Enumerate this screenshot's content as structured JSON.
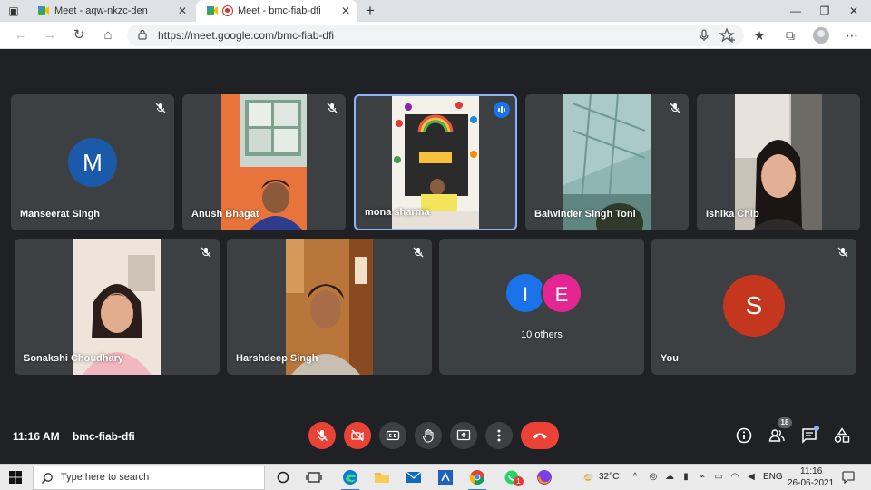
{
  "browser": {
    "tabs": [
      {
        "title": "Meet - aqw-nkzc-den"
      },
      {
        "title": "Meet - bmc-fiab-dfi"
      }
    ],
    "close_glyph": "✕",
    "new_tab_glyph": "+",
    "window_controls": {
      "minimize": "—",
      "restore": "❐",
      "close": "✕"
    },
    "url": "https://meet.google.com/bmc-fiab-dfi",
    "nav": {
      "back": "←",
      "forward": "→",
      "reload": "↻",
      "home": "⌂"
    },
    "toolbar": {
      "favorites": "☆",
      "favorites_bar": "★",
      "collections": "⧉",
      "more": "⋯"
    }
  },
  "meet": {
    "participants_row1": [
      {
        "name": "Manseerat Singh",
        "avatar_letter": "M",
        "avatar_color": "#1a5aa8"
      },
      {
        "name": "Anush Bhagat"
      },
      {
        "name": "mona sharma"
      },
      {
        "name": "Balwinder Singh Toni"
      },
      {
        "name": "Ishika Chib"
      }
    ],
    "participants_row2": [
      {
        "name": "Sonakshi Choudhary"
      },
      {
        "name": "Harshdeep Singh"
      },
      {
        "name": "10 others",
        "avatar_letters": [
          "I",
          "E"
        ],
        "avatar_colors": [
          "#1a73e8",
          "#e52592"
        ]
      },
      {
        "name": "You",
        "avatar_letter": "S",
        "avatar_color": "#c5361f"
      }
    ],
    "time": "11:16 AM",
    "meeting_code": "bmc-fiab-dfi",
    "people_count": "18",
    "colors": {
      "background": "#202124",
      "tile": "#3c4043",
      "danger": "#ea4335",
      "active_border": "#8ab4f8"
    }
  },
  "taskbar": {
    "search_placeholder": "Type here to search",
    "weather": "32°C",
    "language": "ENG",
    "clock_time": "11:16",
    "clock_date": "26-06-2021",
    "notification_count": "1"
  }
}
